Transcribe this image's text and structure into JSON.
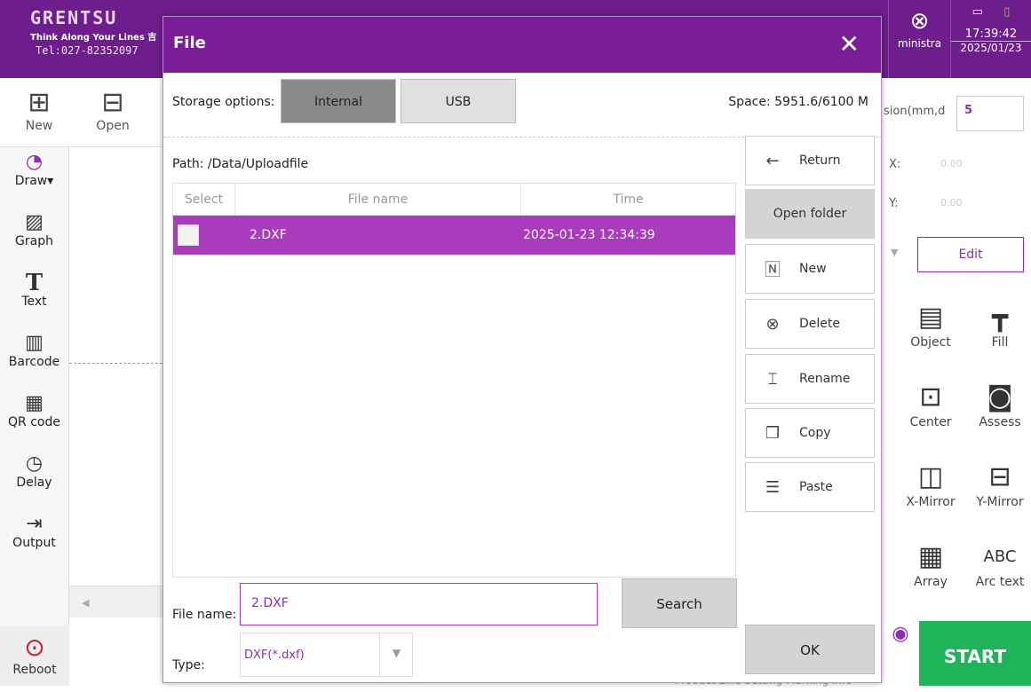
{
  "header": {
    "brand": "GRENTSU",
    "tagline": "Think Along Your Lines 吉",
    "tel": "Tel:027-82352097",
    "user": "ministra",
    "time": "17:39:42",
    "date": "2025/01/23"
  },
  "toolbar": {
    "new_label": "New",
    "open_label": "Open"
  },
  "sidebar": {
    "items": [
      {
        "label": "Draw",
        "icon": "draw-icon"
      },
      {
        "label": "Graph",
        "icon": "graph-icon"
      },
      {
        "label": "Text",
        "icon": "text-icon"
      },
      {
        "label": "Barcode",
        "icon": "barcode-icon"
      },
      {
        "label": "QR code",
        "icon": "qr-code-icon"
      },
      {
        "label": "Delay",
        "icon": "clock-icon"
      },
      {
        "label": "Output",
        "icon": "output-icon"
      }
    ],
    "reboot_label": "Reboot"
  },
  "right_panel": {
    "precision_label": "sion(mm,d",
    "precision_value": "5",
    "x_label": "X:",
    "x_value": "0.00",
    "y_label": "Y:",
    "y_value": "0.00",
    "edit_label": "Edit",
    "tools": [
      {
        "label": "Object",
        "icon": "object-icon"
      },
      {
        "label": "Fill",
        "icon": "fill-icon"
      },
      {
        "label": "Center",
        "icon": "center-icon"
      },
      {
        "label": "Assess",
        "icon": "assess-icon"
      },
      {
        "label": "X-Mirror",
        "icon": "x-mirror-icon"
      },
      {
        "label": "Y-Mirror",
        "icon": "y-mirror-icon"
      },
      {
        "label": "Array",
        "icon": "array-icon"
      },
      {
        "label": "Arc text",
        "icon": "arc-text-icon"
      }
    ],
    "start_label": "START"
  },
  "bottom": {
    "text": "Product Line    Setting    Marking info"
  },
  "dialog": {
    "title": "File",
    "storage_label": "Storage options:",
    "storage_options": [
      "Internal",
      "USB"
    ],
    "storage_selected": "Internal",
    "space": "Space: 5951.6/6100 M",
    "path": "Path:  /Data/Uploadfile",
    "columns": [
      "Select",
      "File name",
      "Time"
    ],
    "rows": [
      {
        "name": "2.DXF",
        "time": "2025-01-23  12:34:39"
      }
    ],
    "buttons": {
      "return": "Return",
      "open_folder": "Open folder",
      "new": "New",
      "delete": "Delete",
      "rename": "Rename",
      "copy": "Copy",
      "paste": "Paste",
      "ok": "OK",
      "search": "Search"
    },
    "file_name_label": "File name:",
    "file_name_value": "2.DXF",
    "type_label": "Type:",
    "type_value": "DXF(*.dxf)"
  },
  "colors": {
    "accent": "#7a1e97",
    "row_selected": "#a93bbd",
    "start": "#1fb35a"
  }
}
